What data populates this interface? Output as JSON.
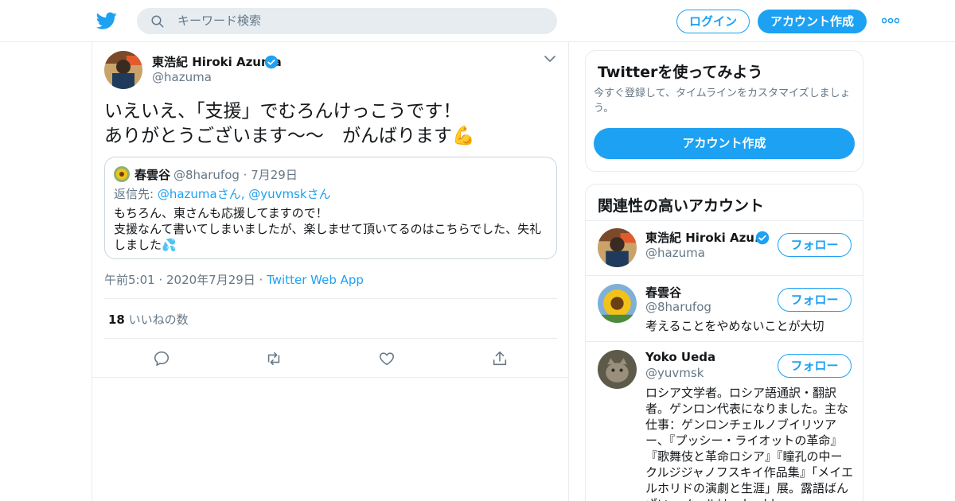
{
  "header": {
    "search_placeholder": "キーワード検索",
    "login_label": "ログイン",
    "signup_label": "アカウント作成"
  },
  "tweet": {
    "author_name": "東浩紀 Hiroki Azuma",
    "author_handle": "@hazuma",
    "text": "いえいえ、「支援」でむろんけっこうです！\nありがとうございます〜〜　がんばります💪",
    "quote": {
      "author_name": "春雲谷",
      "handle_date": "@8harufog · 7月29日",
      "reply_prefix": "返信先: ",
      "reply_users": "@hazumaさん, @yuvmskさん",
      "text": "もちろん、東さんも応援してますので！\n支援なんて書いてしまいましたが、楽しませて頂いてるのはこちらでした、失礼しました💦"
    },
    "meta_time": "午前5:01 · 2020年7月29日 · ",
    "meta_source": "Twitter Web App",
    "likes_count": "18",
    "likes_label": " いいねの数"
  },
  "sidebar": {
    "try_title": "Twitterを使ってみよう",
    "try_desc": "今すぐ登録して、タイムラインをカスタマイズしましょう。",
    "try_button": "アカウント作成",
    "related_title": "関連性の高いアカウント",
    "accounts": [
      {
        "name": "東浩紀 Hiroki Azu...",
        "handle": "@hazuma",
        "bio": "",
        "follow_label": "フォロー",
        "verified": true
      },
      {
        "name": "春雲谷",
        "handle": "@8harufog",
        "bio": "考えることをやめないことが大切",
        "follow_label": "フォロー",
        "verified": false
      },
      {
        "name": "Yoko Ueda",
        "handle": "@yuvmsk",
        "bio": "ロシア文学者。ロシア語通訳・翻訳者。ゲンロン代表になりました。主な仕事：ゲンロンチェルノブイリツアー、『プッシー・ライオットの革命』『歌舞伎と革命ロシア』『瞳孔の中ークルジジャノフスキイ作品集』「メイエルホリドの演劇と生涯」展。露語ばんざい。メールはyokochka",
        "follow_label": "フォロー",
        "verified": false
      }
    ]
  },
  "colors": {
    "accent": "#1da1f2",
    "text_primary": "#14171a",
    "text_secondary": "#657786",
    "border": "#e6ecf0"
  },
  "icons": [
    "twitter-logo-icon",
    "search-icon",
    "more-icon",
    "verified-icon",
    "chevron-down-icon",
    "reply-icon",
    "retweet-icon",
    "like-icon",
    "share-icon"
  ]
}
